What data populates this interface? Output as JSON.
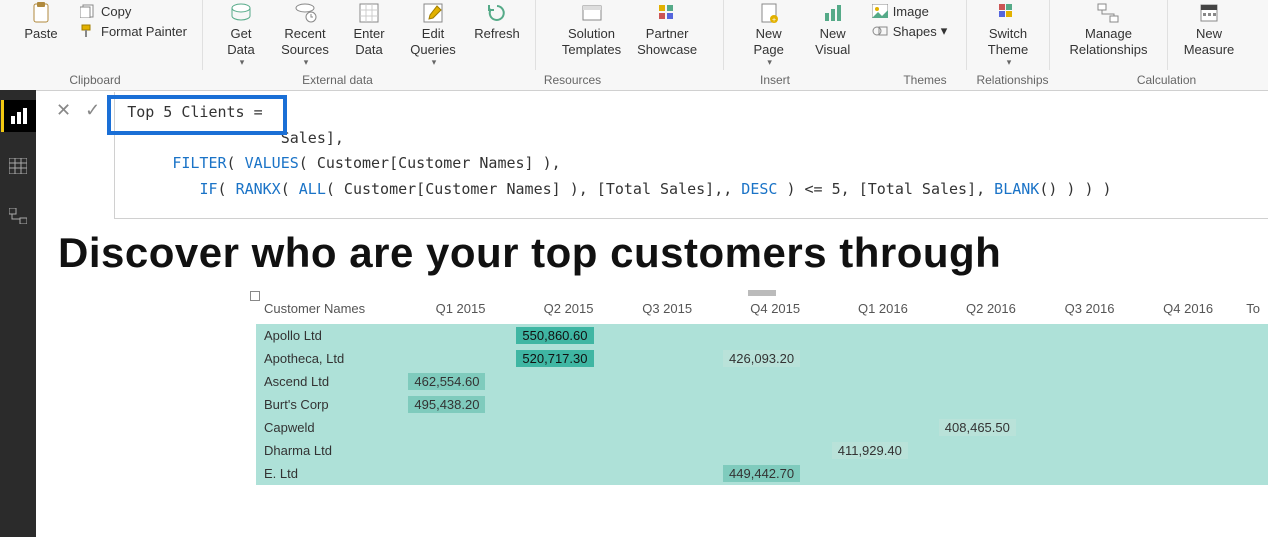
{
  "ribbon": {
    "paste": "Paste",
    "copy": "Copy",
    "format_painter": "Format Painter",
    "get_data": "Get\nData",
    "recent_sources": "Recent\nSources",
    "enter_data": "Enter\nData",
    "edit_queries": "Edit\nQueries",
    "refresh": "Refresh",
    "solution_templates": "Solution\nTemplates",
    "partner_showcase": "Partner\nShowcase",
    "new_page": "New\nPage",
    "new_visual": "New\nVisual",
    "image": "Image",
    "shapes": "Shapes",
    "switch_theme": "Switch\nTheme",
    "manage_relationships": "Manage\nRelationships",
    "new_measure": "New\nMeasure"
  },
  "ribbon_groups": {
    "clipboard": "Clipboard",
    "external_data": "External data",
    "resources": "Resources",
    "insert": "Insert",
    "themes": "Themes",
    "relationships": "Relationships",
    "calculations": "Calculation"
  },
  "formula": {
    "line1": "Top 5 Clients =",
    "line2_prefix": "                 Sales],",
    "line3": "     FILTER( VALUES( Customer[Customer Names] ),",
    "line4": "        IF( RANKX( ALL( Customer[Customer Names] ), [Total Sales],, DESC ) <= 5, [Total Sales], BLANK() ) ) )"
  },
  "headline": "Discover who are your top customers through ",
  "matrix": {
    "row_header": "Customer Names",
    "columns": [
      "Q1 2015",
      "Q2 2015",
      "Q3 2015",
      "Q4 2015",
      "Q1 2016",
      "Q2 2016",
      "Q3 2016",
      "Q4 2016",
      "To"
    ],
    "rows": [
      {
        "name": "Apollo Ltd",
        "cells": [
          "",
          "550,860.60",
          "",
          "",
          "",
          "",
          "",
          "",
          ""
        ]
      },
      {
        "name": "Apotheca, Ltd",
        "cells": [
          "",
          "520,717.30",
          "",
          "426,093.20",
          "",
          "",
          "",
          "",
          ""
        ]
      },
      {
        "name": "Ascend Ltd",
        "cells": [
          "462,554.60",
          "",
          "",
          "",
          "",
          "",
          "",
          "",
          ""
        ]
      },
      {
        "name": "Burt's Corp",
        "cells": [
          "495,438.20",
          "",
          "",
          "",
          "",
          "",
          "",
          "",
          ""
        ]
      },
      {
        "name": "Capweld",
        "cells": [
          "",
          "",
          "",
          "",
          "",
          "408,465.50",
          "",
          "",
          ""
        ]
      },
      {
        "name": "Dharma Ltd",
        "cells": [
          "",
          "",
          "",
          "",
          "411,929.40",
          "",
          "",
          "",
          ""
        ]
      },
      {
        "name": "E. Ltd",
        "cells": [
          "",
          "",
          "",
          "449,442.70",
          "",
          "",
          "",
          "",
          ""
        ]
      }
    ],
    "cell_tone": [
      [
        "",
        "hi",
        "",
        "",
        "",
        "",
        "",
        "",
        ""
      ],
      [
        "",
        "hi",
        "",
        "lo",
        "",
        "",
        "",
        "",
        ""
      ],
      [
        "md",
        "",
        "",
        "",
        "",
        "",
        "",
        "",
        ""
      ],
      [
        "md",
        "",
        "",
        "",
        "",
        "",
        "",
        "",
        ""
      ],
      [
        "",
        "",
        "",
        "",
        "",
        "lo",
        "",
        "",
        ""
      ],
      [
        "",
        "",
        "",
        "",
        "lo",
        "",
        "",
        "",
        ""
      ],
      [
        "",
        "",
        "",
        "md",
        "",
        "",
        "",
        "",
        ""
      ]
    ]
  }
}
